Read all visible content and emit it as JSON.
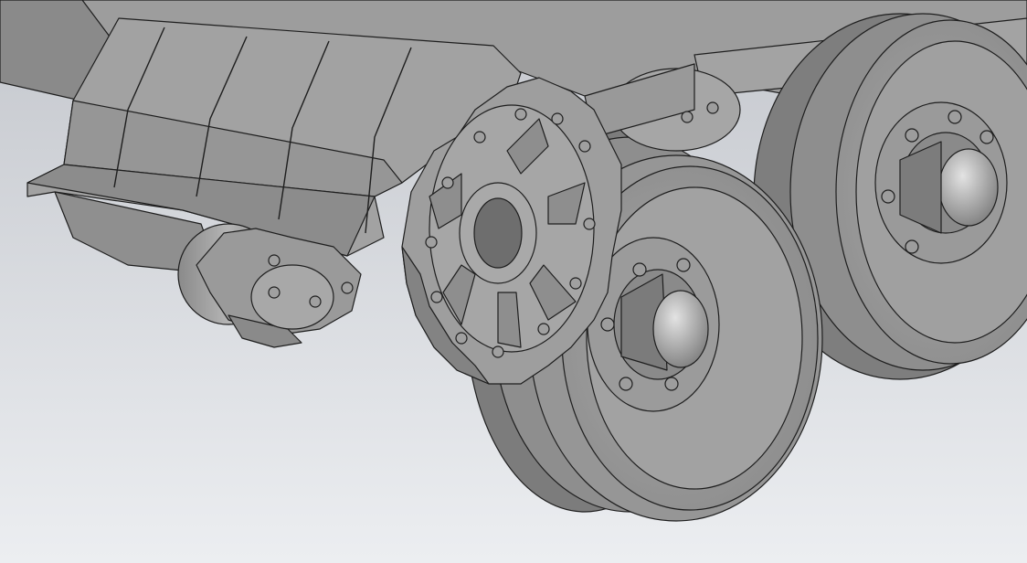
{
  "colors": {
    "bg_top": "#c6c9cf",
    "bg_bottom": "#e9ebee",
    "metal_light": "#a9a9a9",
    "metal_mid": "#8f8f8f",
    "metal_dark": "#6a6a6a",
    "edge": "#1e1e1e"
  },
  "scene": {
    "parts": [
      "frame-rail",
      "fender-cover",
      "drive-sprocket-rear",
      "drive-sprocket-front",
      "road-wheel-front",
      "road-wheel-rear",
      "hub-cap",
      "motor-housing"
    ]
  }
}
